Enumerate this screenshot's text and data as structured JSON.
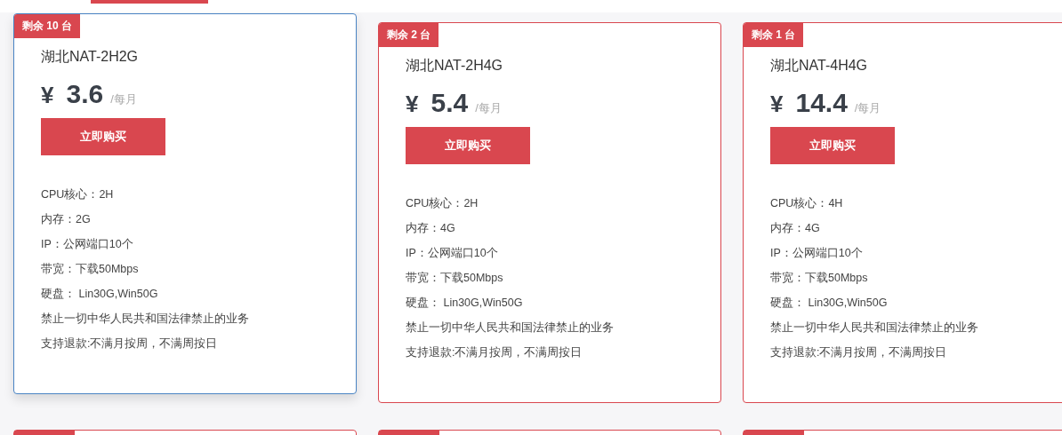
{
  "plans": [
    {
      "stock": "剩余 10 台",
      "name": "湖北NAT-2H2G",
      "currency": "¥",
      "price": "3.6",
      "period": "/每月",
      "button": "立即购买",
      "selected": true,
      "specs": [
        "CPU核心：2H",
        "内存：2G",
        "IP：公网端口10个",
        "带宽：下载50Mbps",
        "硬盘： Lin30G,Win50G",
        "禁止一切中华人民共和国法律禁止的业务",
        "支持退款:不满月按周，不满周按日"
      ]
    },
    {
      "stock": "剩余 2 台",
      "name": "湖北NAT-2H4G",
      "currency": "¥",
      "price": "5.4",
      "period": "/每月",
      "button": "立即购买",
      "selected": false,
      "specs": [
        "CPU核心：2H",
        "内存：4G",
        "IP：公网端口10个",
        "带宽：下载50Mbps",
        "硬盘： Lin30G,Win50G",
        "禁止一切中华人民共和国法律禁止的业务",
        "支持退款:不满月按周，不满周按日"
      ]
    },
    {
      "stock": "剩余 1 台",
      "name": "湖北NAT-4H4G",
      "currency": "¥",
      "price": "14.4",
      "period": "/每月",
      "button": "立即购买",
      "selected": false,
      "specs": [
        "CPU核心：4H",
        "内存：4G",
        "IP：公网端口10个",
        "带宽：下载50Mbps",
        "硬盘： Lin30G,Win50G",
        "禁止一切中华人民共和国法律禁止的业务",
        "支持退款:不满月按周，不满周按日"
      ]
    }
  ]
}
